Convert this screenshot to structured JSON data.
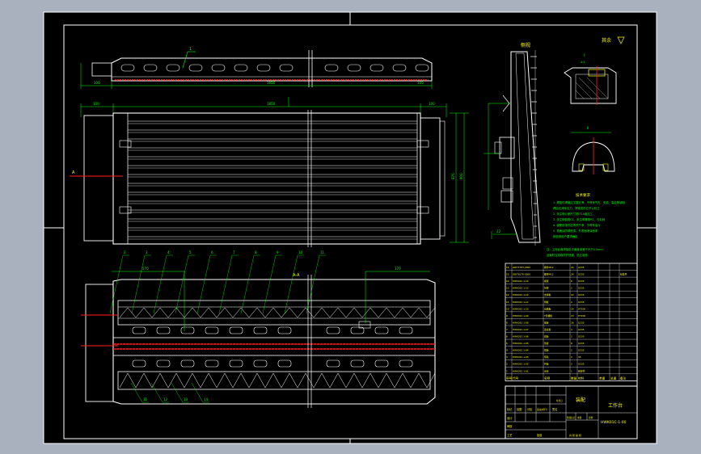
{
  "colors": {
    "canvas_bg": "#a9b1bf",
    "sheet_bg": "#000000",
    "line_white": "#ffffff",
    "line_green": "#00ff00",
    "line_red": "#ff2020",
    "line_yellow": "#ffff00"
  },
  "top_view": {
    "callout": "1",
    "dim_left": "100",
    "dim_total": "1850",
    "dim_right": "100"
  },
  "plan_view": {
    "dim_left": "100",
    "dim_total": "1850",
    "dim_right": "100",
    "height_a": "870",
    "height_b": "900",
    "section_mark": "A"
  },
  "front_view": {
    "section_label": "A-A",
    "dim_left": "570",
    "dim_right": "370",
    "callouts_top": [
      "2",
      "3",
      "4",
      "5",
      "6",
      "7",
      "8",
      "9",
      "10",
      "11"
    ],
    "callouts_bottom": [
      "11",
      "12",
      "13",
      "14"
    ]
  },
  "side_view": {
    "title": "侧视",
    "dim_bottom": "22"
  },
  "details": {
    "surface_label": "其余",
    "detail_1": "I",
    "detail_1_scale": "4:1",
    "detail_2": "II"
  },
  "notes": {
    "title": "技术要求",
    "lines": [
      "1. 焊接件焊缝应平整光滑，不得有气孔、夹渣、裂纹等缺陷",
      "   焊后应消除应力，焊接变形应予以校正",
      "2. 未注明公差尺寸按IT14级加工",
      "3. 未注明倒角C1，未注明圆角R2，去毛刺",
      "4. 装配前零件应清洗干净，不得有油污",
      "5. 表面涂防锈底漆，外表面喷涂面漆",
      "   颜色按用户要求确定"
    ],
    "note_2_lines": [
      "注：工作台面拼接处平面度误差不大于0.5mm",
      "    运输时应采取防护措施，防止碰伤"
    ]
  },
  "bom": {
    "headers": [
      "序号",
      "代号",
      "名称",
      "数量",
      "材料",
      "单重",
      "总重",
      "备注"
    ],
    "rows": [
      [
        "16",
        "GB/T5783-2000",
        "螺栓M12",
        "24",
        "Q235",
        "",
        "",
        ""
      ],
      [
        "15",
        "GB/T6170-2000",
        "螺母M12",
        "24",
        "Q235",
        "",
        "",
        "标准件"
      ],
      [
        "14",
        "HWK01C-1-14",
        "横梁",
        "6",
        "Q235",
        "",
        "",
        ""
      ],
      [
        "13",
        "HWK01C-1-13",
        "纵梁",
        "2",
        "Q235",
        "",
        "",
        ""
      ],
      [
        "12",
        "HWK01C-1-12",
        "支撑板",
        "12",
        "Q235",
        "",
        "",
        ""
      ],
      [
        "11",
        "HWK01C-1-11",
        "侧板",
        "2",
        "Q235",
        "",
        "",
        ""
      ],
      [
        "10",
        "HWK01C-1-10",
        "台面板",
        "14",
        "HT200",
        "",
        "",
        ""
      ],
      [
        "9",
        "HWK01C-1-09",
        "T形槽板",
        "13",
        "HT200",
        "",
        "",
        ""
      ],
      [
        "8",
        "HWK01C-1-08",
        "筋板",
        "26",
        "Q235",
        "",
        "",
        ""
      ],
      [
        "7",
        "HWK01C-1-07",
        "连接板",
        "4",
        "Q235",
        "",
        "",
        ""
      ],
      [
        "6",
        "HWK01C-1-06",
        "底板",
        "2",
        "Q235",
        "",
        "",
        ""
      ],
      [
        "5",
        "HWK01C-1-05",
        "垫板",
        "8",
        "Q235",
        "",
        "",
        ""
      ],
      [
        "4",
        "HWK01C-1-04",
        "端板",
        "2",
        "Q235",
        "",
        "",
        ""
      ],
      [
        "3",
        "HWK01C-1-03",
        "导轨",
        "2",
        "45",
        "",
        "",
        ""
      ],
      [
        "2",
        "HWK01C-1-02",
        "护板",
        "2",
        "Q235",
        "",
        "",
        ""
      ],
      [
        "1",
        "HWK01C-1-01",
        "台架",
        "1",
        "组焊件",
        "",
        "",
        ""
      ]
    ]
  },
  "title_block": {
    "product_name": "装配",
    "drawing_title": "工作台",
    "drawing_no": "HWK01C-1-00",
    "labels": [
      "标记",
      "处数",
      "分区",
      "更改文件号",
      "签名",
      "年月日",
      "设计",
      "审核",
      "工艺",
      "批准"
    ],
    "stage_labels": [
      "阶段标记",
      "重量",
      "比例"
    ],
    "sheet_info": "共 张 第 张"
  }
}
